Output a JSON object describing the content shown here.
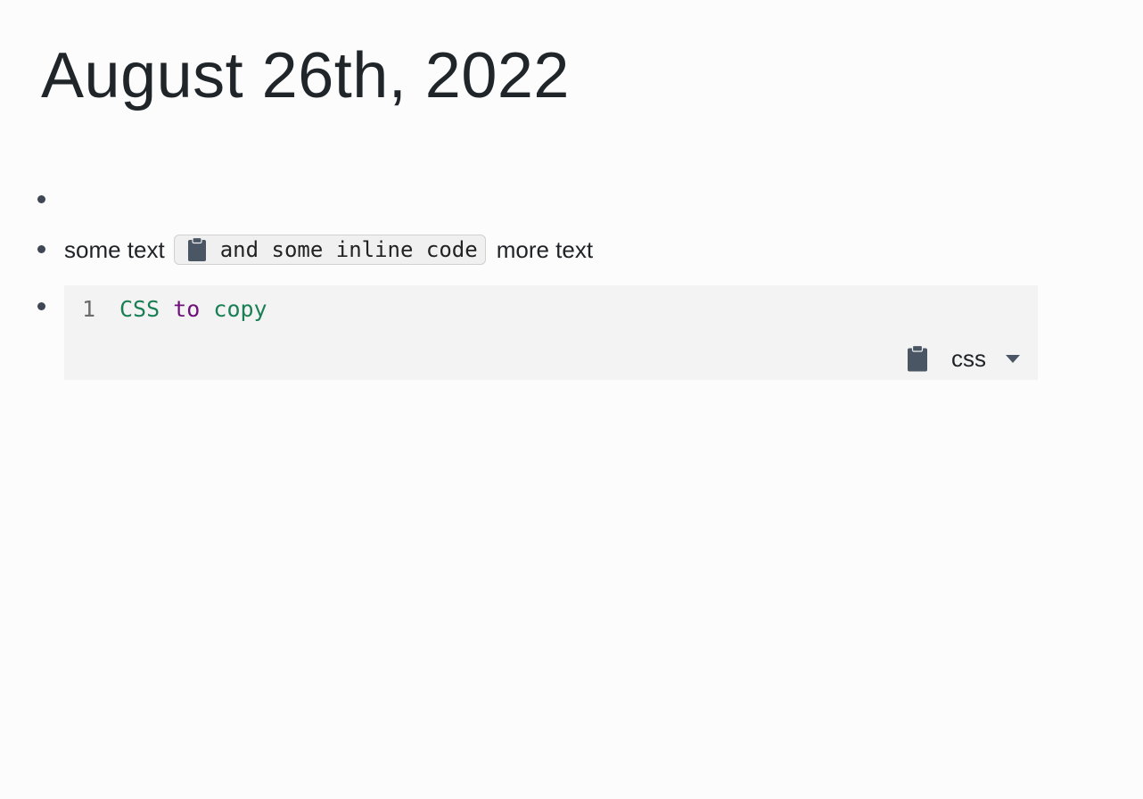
{
  "page": {
    "title": "August 26th, 2022"
  },
  "blocks": [
    {
      "type": "empty"
    },
    {
      "type": "text",
      "before": "some text",
      "inline_code": "and some inline code",
      "after": "more text"
    },
    {
      "type": "code",
      "line_number": "1",
      "tokens": [
        "CSS",
        "to",
        "copy"
      ],
      "language": "css"
    }
  ],
  "icons": {
    "copy": "clipboard-icon",
    "language_dropdown": "chevron-down-icon"
  },
  "colors": {
    "background": "#fcfcfc",
    "title": "#1f2529",
    "bullet": "#3f4852",
    "code_bg": "#f3f3f3",
    "inline_code_bg": "#f0f0f0",
    "token_green": "#1a7f54",
    "token_purple": "#6f117a",
    "icon": "#4b5665"
  }
}
